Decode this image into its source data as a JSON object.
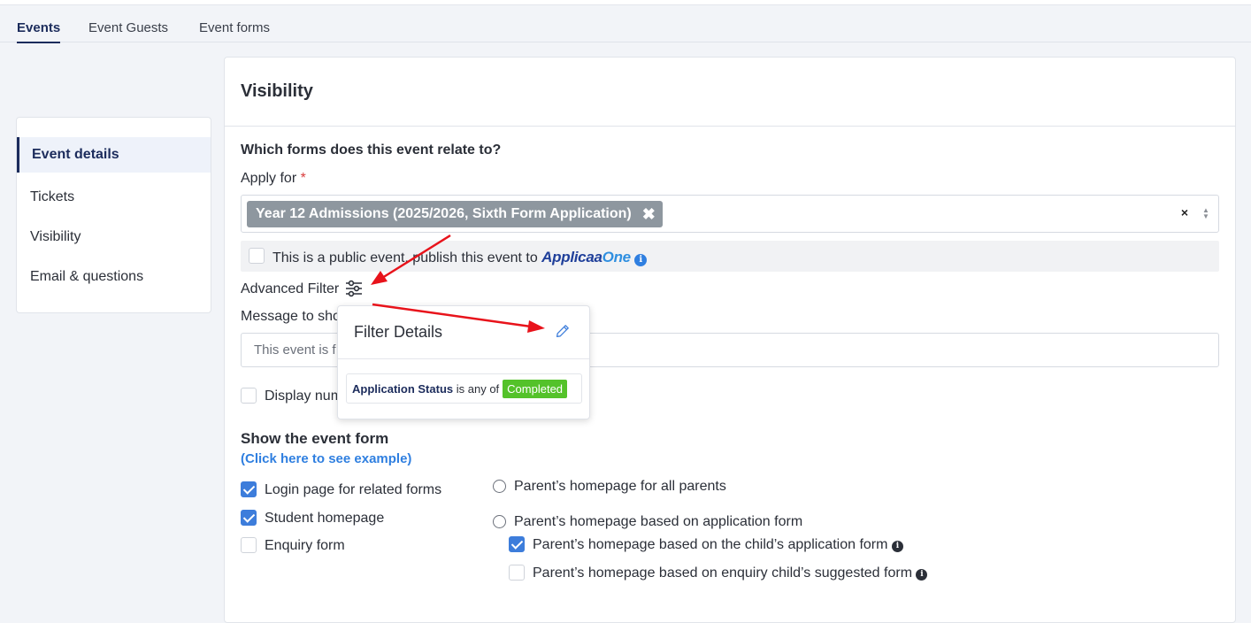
{
  "tabs": [
    {
      "label": "Events",
      "active": true
    },
    {
      "label": "Event Guests",
      "active": false
    },
    {
      "label": "Event forms",
      "active": false
    }
  ],
  "sidebar": {
    "items": [
      {
        "label": "Event details",
        "active": true
      },
      {
        "label": "Tickets"
      },
      {
        "label": "Visibility"
      },
      {
        "label": "Email & questions"
      }
    ]
  },
  "card": {
    "title": "Visibility"
  },
  "forms_section": {
    "question": "Which forms does this event relate to?",
    "apply_for_label": "Apply for",
    "required_mark": "*",
    "selected_tag": "Year 12 Admissions (2025/2026, Sixth Form Application)",
    "tag_remove_glyph": "✖",
    "clear_glyph": "×"
  },
  "public_event": {
    "label": "This is a public event, publish this event to",
    "brand_part1": "Applicaa",
    "brand_part2": "One",
    "checked": false
  },
  "advanced_filter": {
    "label": "Advanced Filter",
    "icon": "sliders-icon"
  },
  "message": {
    "label": "Message to sho",
    "value": "This event is f"
  },
  "display_num": {
    "label": "Display num",
    "checked": false
  },
  "popover": {
    "title": "Filter Details",
    "rule_field": "Application Status",
    "rule_operator": "is any of",
    "rule_value": "Completed"
  },
  "event_form": {
    "title": "Show the event form",
    "example_link": "(Click here to see example)",
    "checkboxes": [
      {
        "label": "Login page for related forms",
        "checked": true
      },
      {
        "label": "Student homepage",
        "checked": true
      },
      {
        "label": "Enquiry form",
        "checked": false
      }
    ],
    "radios": [
      {
        "label": "Parent’s homepage for all parents",
        "selected": false
      },
      {
        "label": "Parent’s homepage based on application form",
        "selected": false
      }
    ],
    "sub_checkboxes": [
      {
        "label": "Parent’s homepage based on the child’s application form",
        "checked": true
      },
      {
        "label": "Parent’s homepage based on enquiry child’s suggested form",
        "checked": false
      }
    ]
  },
  "colors": {
    "accent": "#1c2c5c",
    "checkbox": "#3d7ddb",
    "tag": "#8e979f",
    "status_completed": "#54c22a",
    "annotation_arrow": "#e8131b"
  }
}
